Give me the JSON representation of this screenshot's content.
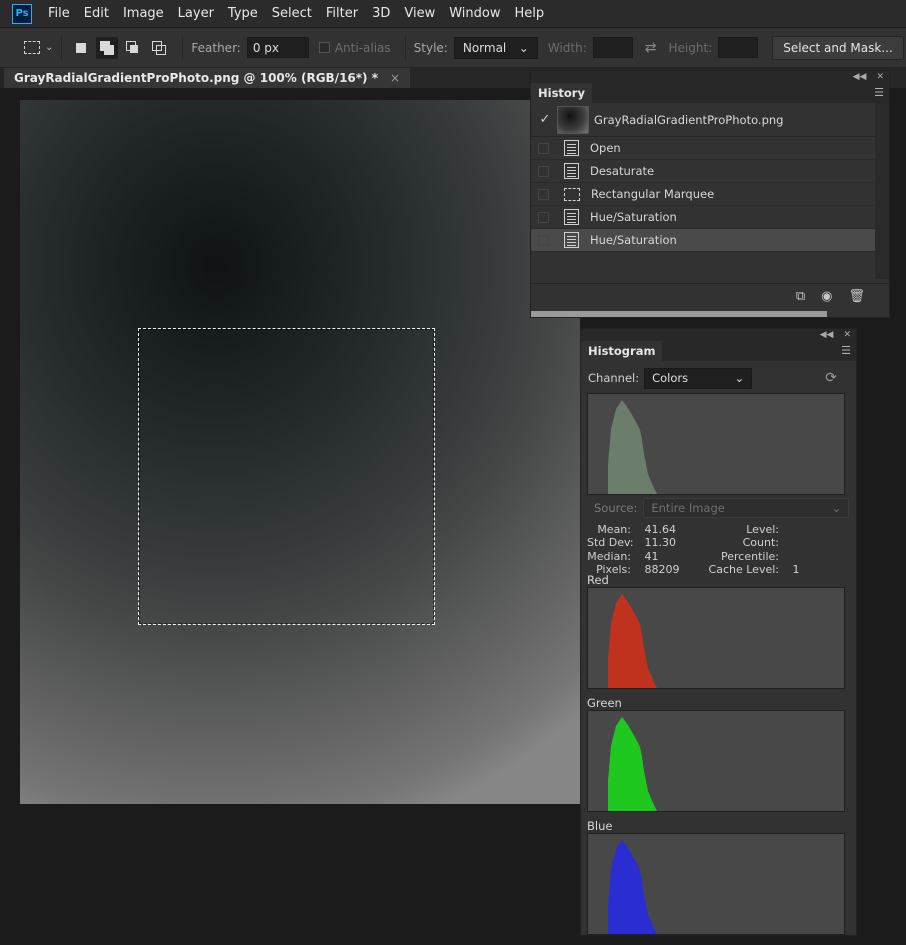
{
  "app": {
    "logo": "Ps"
  },
  "menu": [
    "File",
    "Edit",
    "Image",
    "Layer",
    "Type",
    "Select",
    "Filter",
    "3D",
    "View",
    "Window",
    "Help"
  ],
  "options": {
    "feather_label": "Feather:",
    "feather_value": "0 px",
    "antialias_label": "Anti-alias",
    "style_label": "Style:",
    "style_value": "Normal",
    "width_label": "Width:",
    "width_value": "",
    "height_label": "Height:",
    "height_value": "",
    "select_mask_label": "Select and Mask..."
  },
  "document": {
    "tab_title": "GrayRadialGradientProPhoto.png @ 100% (RGB/16*) *",
    "close_glyph": "×"
  },
  "history": {
    "title": "History",
    "snapshot_name": "GrayRadialGradientProPhoto.png",
    "items": [
      {
        "label": "Open",
        "icon": "document-icon"
      },
      {
        "label": "Desaturate",
        "icon": "document-icon"
      },
      {
        "label": "Rectangular Marquee",
        "icon": "marquee-icon"
      },
      {
        "label": "Hue/Saturation",
        "icon": "document-icon"
      },
      {
        "label": "Hue/Saturation",
        "icon": "document-icon",
        "active": true
      }
    ]
  },
  "histogram": {
    "title": "Histogram",
    "channel_label": "Channel:",
    "channel_value": "Colors",
    "source_label": "Source:",
    "source_value": "Entire Image",
    "stats": {
      "mean_label": "Mean:",
      "mean": "41.64",
      "stddev_label": "Std Dev:",
      "stddev": "11.30",
      "median_label": "Median:",
      "median": "41",
      "pixels_label": "Pixels:",
      "pixels": "88209",
      "level_label": "Level:",
      "level": "",
      "count_label": "Count:",
      "count": "",
      "percentile_label": "Percentile:",
      "percentile": "",
      "cache_label": "Cache Level:",
      "cache": "1"
    },
    "channels": [
      {
        "name": "",
        "color": "#6b7d6b"
      },
      {
        "name": "Red",
        "color": "#c0321e"
      },
      {
        "name": "Green",
        "color": "#1ec81e"
      },
      {
        "name": "Blue",
        "color": "#2a2ed2"
      }
    ]
  },
  "colors": {
    "accent": "#31a8ff",
    "panel_bg": "#323232",
    "canvas_bg": "#1b1b1b"
  }
}
